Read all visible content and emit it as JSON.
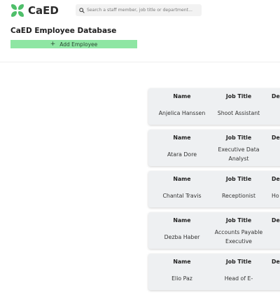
{
  "app": {
    "brand_name": "CaED",
    "brand_color": "#4fbf6a"
  },
  "search": {
    "placeholder": "Search a staff member, job title or department..."
  },
  "page": {
    "title": "CaED Employee Database",
    "add_button_label": "Add Employee",
    "add_button_color": "#8ee6a3"
  },
  "employees": [
    {
      "name_header": "Name",
      "job_header": "Job Title",
      "dept_header": "De",
      "name": "Anjelica Hanssen",
      "job": "Shoot Assistant",
      "dept": ""
    },
    {
      "name_header": "Name",
      "job_header": "Job Title",
      "dept_header": "De",
      "name": "Atara Dore",
      "job": "Executive Data Analyst",
      "dept": ""
    },
    {
      "name_header": "Name",
      "job_header": "Job Title",
      "dept_header": "De",
      "name": "Chantal Travis",
      "job": "Receptionist",
      "dept": "Ho"
    },
    {
      "name_header": "Name",
      "job_header": "Job Title",
      "dept_header": "De",
      "name": "Dezba Haber",
      "job": "Accounts Payable Executive",
      "dept": ""
    },
    {
      "name_header": "Name",
      "job_header": "Job Title",
      "dept_header": "De",
      "name": "Elio Paz",
      "job": "Head of E-",
      "dept": ""
    }
  ]
}
